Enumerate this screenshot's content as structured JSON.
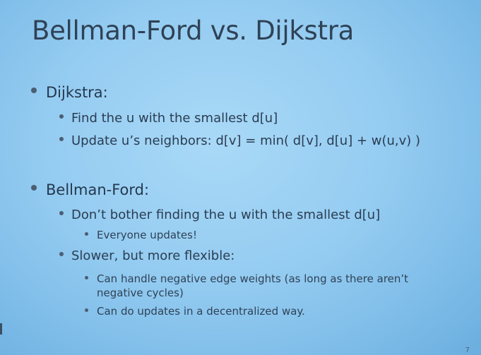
{
  "slide": {
    "title": "Bellman-Ford vs. Dijkstra",
    "page_number": "7",
    "sections": [
      {
        "heading": "Dijkstra:",
        "items": [
          {
            "text": "Find the u with the smallest d[u]"
          },
          {
            "text": "Update u’s neighbors: d[v] = min( d[v], d[u] + w(u,v) )"
          }
        ]
      },
      {
        "heading": "Bellman-Ford:",
        "items": [
          {
            "text": "Don’t bother finding the u with the smallest d[u]",
            "subitems": [
              "Everyone updates!"
            ]
          },
          {
            "text": "Slower, but more flexible:",
            "subitems": [
              "Can handle negative edge weights (as long as there aren’t negative cycles)",
              "Can do updates in a decentralized way."
            ]
          }
        ]
      }
    ]
  }
}
